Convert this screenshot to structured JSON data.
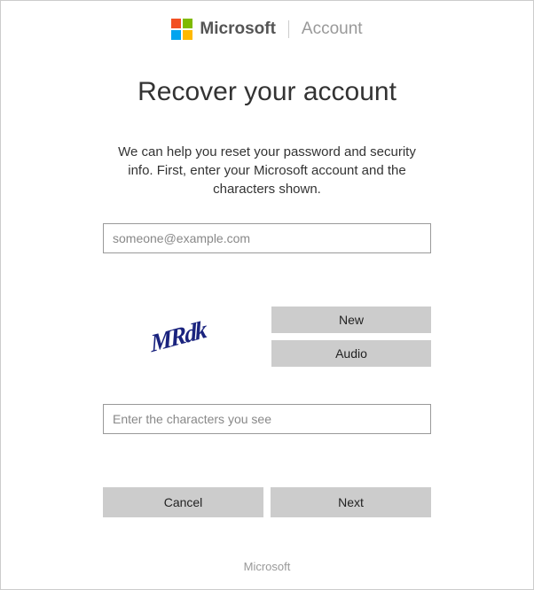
{
  "header": {
    "brand": "Microsoft",
    "section": "Account"
  },
  "main": {
    "title": "Recover your account",
    "description": "We can help you reset your password and security info. First, enter your Microsoft account and the characters shown.",
    "email_placeholder": "someone@example.com",
    "captcha_value": "MRdk",
    "captcha_new_label": "New",
    "captcha_audio_label": "Audio",
    "captcha_input_placeholder": "Enter the characters you see",
    "cancel_label": "Cancel",
    "next_label": "Next"
  },
  "footer": {
    "text": "Microsoft"
  }
}
